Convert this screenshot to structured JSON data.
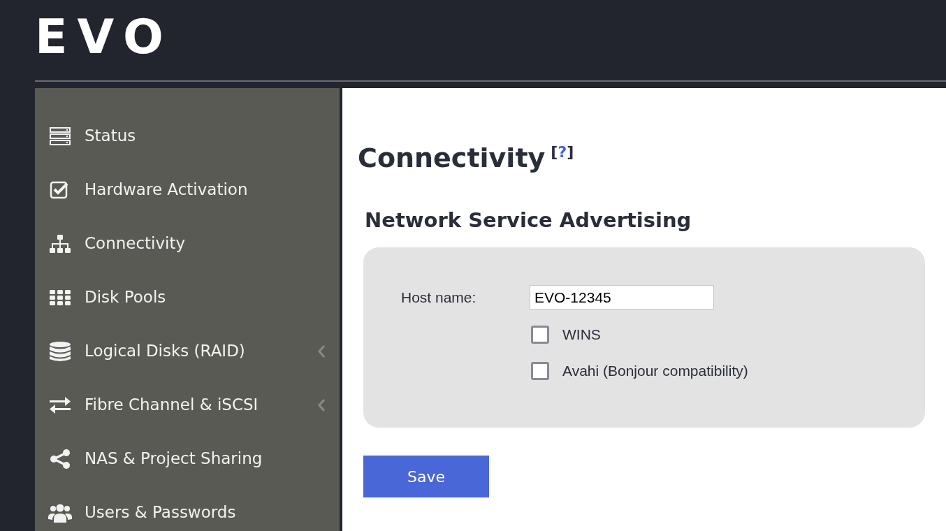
{
  "logo": {
    "text": "EVO"
  },
  "sidebar": {
    "items": [
      {
        "label": "Status",
        "has_submenu": false
      },
      {
        "label": "Hardware Activation",
        "has_submenu": false
      },
      {
        "label": "Connectivity",
        "has_submenu": false
      },
      {
        "label": "Disk Pools",
        "has_submenu": false
      },
      {
        "label": "Logical Disks (RAID)",
        "has_submenu": true
      },
      {
        "label": "Fibre Channel & iSCSI",
        "has_submenu": true
      },
      {
        "label": "NAS & Project Sharing",
        "has_submenu": false
      },
      {
        "label": "Users & Passwords",
        "has_submenu": false
      }
    ]
  },
  "page": {
    "title": "Connectivity",
    "help_link": {
      "open": "[",
      "symbol": "?",
      "close": "]"
    }
  },
  "section": {
    "title": "Network Service Advertising",
    "host_name": {
      "label": "Host name:",
      "value": "EVO-12345"
    },
    "options": [
      {
        "label": "WINS",
        "checked": false
      },
      {
        "label": "Avahi (Bonjour compatibility)",
        "checked": false
      }
    ]
  },
  "buttons": [
    {
      "label": "Save"
    }
  ]
}
